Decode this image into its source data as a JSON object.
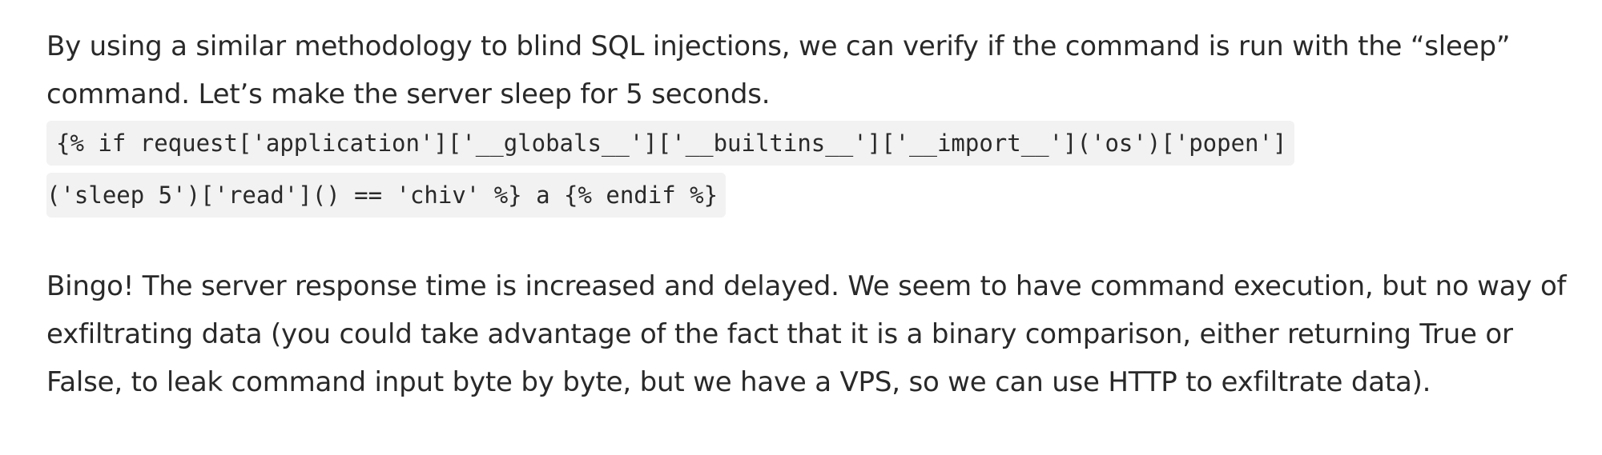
{
  "article": {
    "paragraph_1": "By using a similar methodology to blind SQL injections, we can verify if the command is run with the “sleep” command. Let’s make the server sleep for 5 seconds.",
    "code": {
      "line_1": "{% if request['application']['__globals__']['__builtins__']['__import__']('os')['popen']",
      "line_2": "('sleep 5')['read']() == 'chiv' %} a {% endif %}"
    },
    "paragraph_2": "Bingo! The server response time is increased and delayed. We seem to have command execution, but no way of exfiltrating data (you could take advantage of the fact that it is a binary comparison, either returning True or False, to leak command input byte by byte, but we have a VPS, so we can use HTTP to exfiltrate data)."
  }
}
